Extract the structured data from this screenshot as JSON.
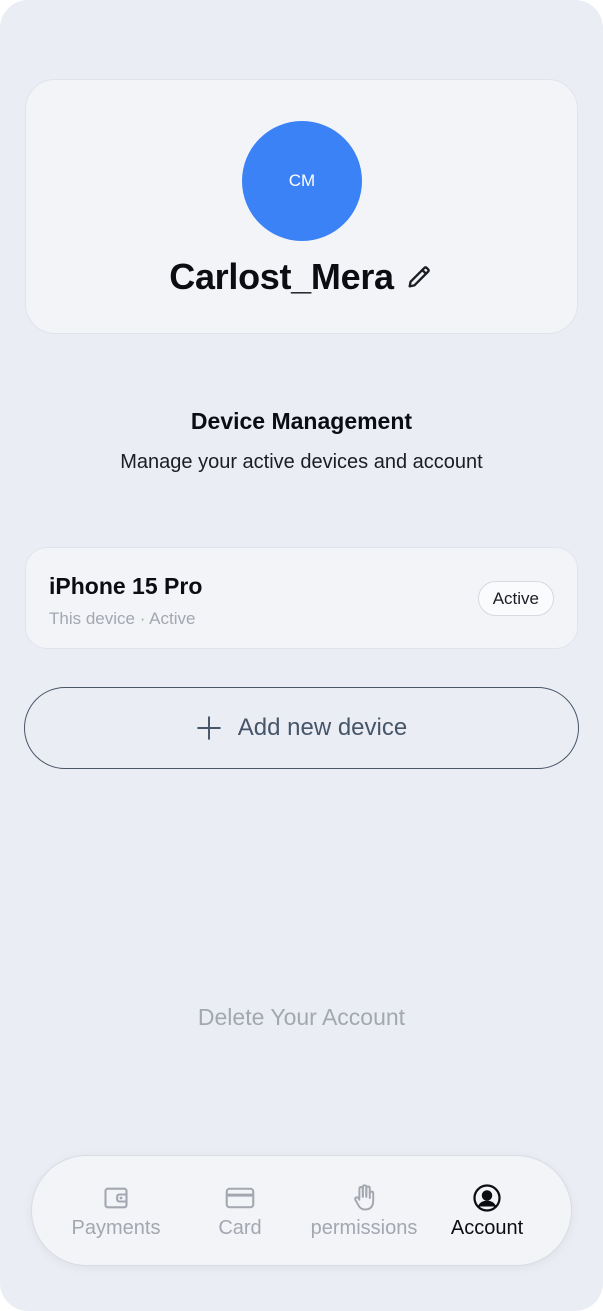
{
  "profile": {
    "initials": "CM",
    "name": "Carlost_Mera",
    "avatar_color": "#3b82f6",
    "edit_icon": "pencil-icon"
  },
  "section": {
    "title": "Device Management",
    "subtitle": "Manage your active devices and account"
  },
  "devices": [
    {
      "name": "iPhone 15 Pro",
      "meta": "This device · Active",
      "badge": "Active"
    }
  ],
  "add_device": {
    "label": "Add new device",
    "icon": "plus-icon"
  },
  "delete_account": {
    "label": "Delete Your Account"
  },
  "tabbar": {
    "active_index": 3,
    "items": [
      {
        "label": "Payments",
        "icon": "wallet-icon"
      },
      {
        "label": "Card",
        "icon": "credit-card-icon"
      },
      {
        "label": "permissions",
        "icon": "hand-icon"
      },
      {
        "label": "Account",
        "icon": "user-circle-icon"
      }
    ]
  },
  "colors": {
    "background": "#eaedf4",
    "card": "#f3f4f8",
    "muted_text": "#a3a7b0",
    "primary_text": "#0b0d12",
    "accent": "#3b82f6"
  }
}
